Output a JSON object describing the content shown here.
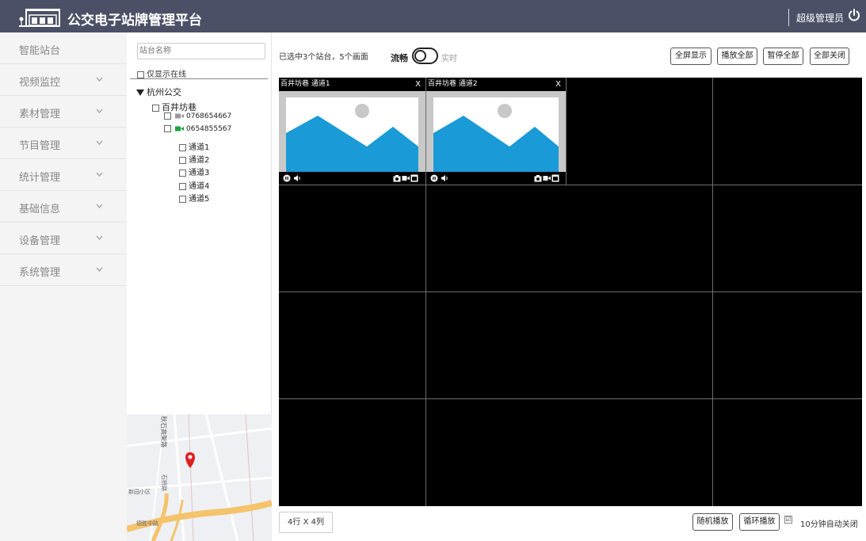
{
  "header": {
    "title": "公交电子站牌管理平台",
    "user": "超级管理员"
  },
  "sidebar": {
    "items": [
      {
        "label": "智能站台",
        "has_chevron": false
      },
      {
        "label": "视频监控",
        "has_chevron": true
      },
      {
        "label": "素材管理",
        "has_chevron": true
      },
      {
        "label": "节目管理",
        "has_chevron": true
      },
      {
        "label": "统计管理",
        "has_chevron": true
      },
      {
        "label": "基础信息",
        "has_chevron": true
      },
      {
        "label": "设备管理",
        "has_chevron": true
      },
      {
        "label": "系统管理",
        "has_chevron": true
      }
    ]
  },
  "tree": {
    "search_placeholder": "站台名称",
    "online_only_label": "仅显示在线",
    "root": "杭州公交",
    "station": "百井坊巷",
    "devices": [
      {
        "id": "0768654667",
        "status": "offline"
      },
      {
        "id": "0654855567",
        "status": "online"
      }
    ],
    "channels": [
      "通道1",
      "通道2",
      "通道3",
      "通道4",
      "通道5"
    ]
  },
  "map": {
    "road_labels": [
      "秋石高架路",
      "石桥路",
      "新园小区",
      "德胜中路"
    ]
  },
  "toolbar": {
    "selection_info": "已选中3个站台，5个画面",
    "stream_label": "流畅",
    "realtime_label": "实时",
    "fullscreen": "全屏显示",
    "play_all": "播放全部",
    "pause_all": "暂停全部",
    "close_all": "全部关闭"
  },
  "videos": [
    {
      "title": "百井坊巷 通道1",
      "close": "X"
    },
    {
      "title": "百井坊巷  通道2",
      "close": "X"
    }
  ],
  "footer": {
    "layout": "4行 X 4列",
    "random_play": "随机播放",
    "loop_play": "循环播放",
    "auto_close_checked": true,
    "auto_close_mark": "☑",
    "auto_close_label": "10分钟自动关闭"
  },
  "colors": {
    "header_bg": "#4b5066",
    "sidebar_bg": "#f4f4f4",
    "image_blue": "#1a9ad6",
    "online_green": "#1aa33d",
    "map_marker": "#e02020"
  }
}
